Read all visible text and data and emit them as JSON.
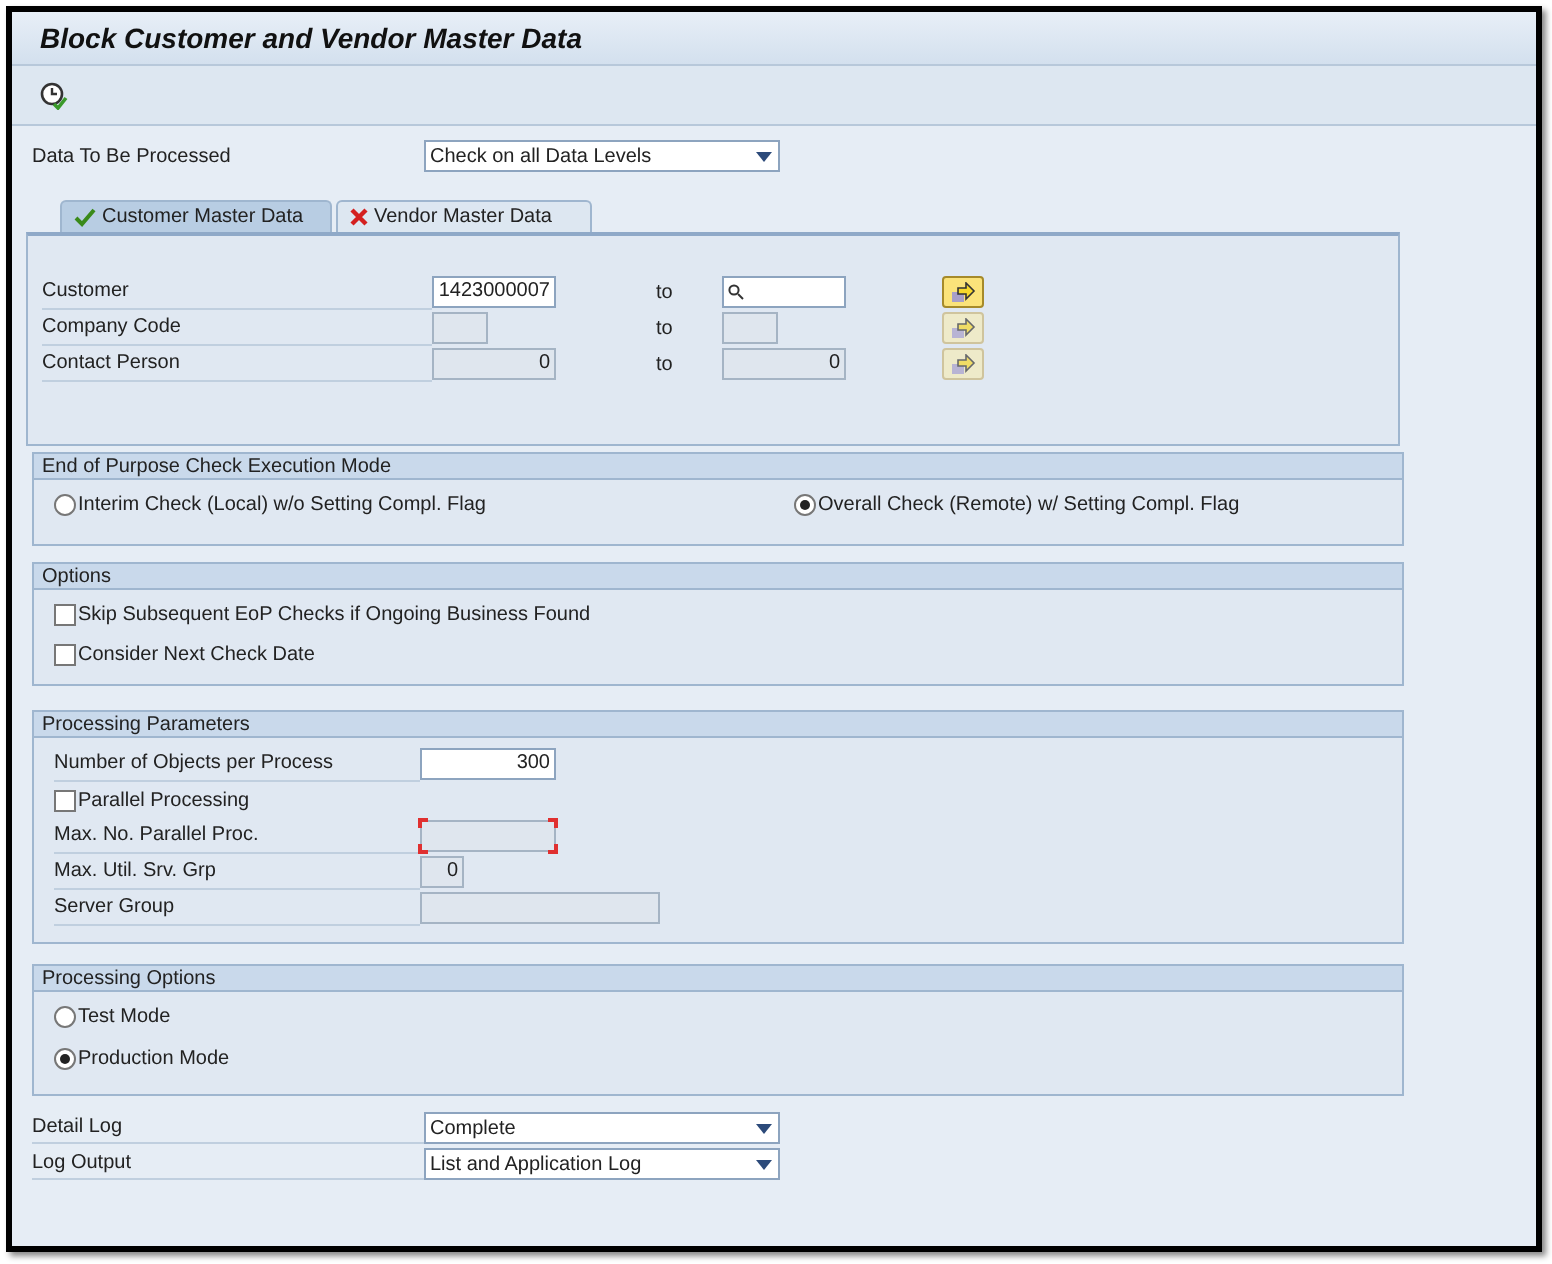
{
  "window": {
    "title": "Block Customer and Vendor Master Data"
  },
  "data_to_be_processed": {
    "label": "Data To Be Processed",
    "value": "Check on all Data Levels"
  },
  "tabs": [
    {
      "label": "Customer Master Data",
      "selected": true,
      "kind": "check"
    },
    {
      "label": "Vendor Master Data",
      "selected": false,
      "kind": "cross"
    }
  ],
  "selection_rows": [
    {
      "label": "Customer",
      "from": "1423000007",
      "to_label": "to",
      "to": "",
      "disabled": false,
      "search": true,
      "active": true
    },
    {
      "label": "Company Code",
      "from": "",
      "to_label": "to",
      "to": "",
      "disabled": true,
      "search": false,
      "active": false
    },
    {
      "label": "Contact Person",
      "from": "0",
      "to_label": "to",
      "to": "0",
      "disabled": true,
      "search": false,
      "active": false
    }
  ],
  "execution_mode": {
    "title": "End of Purpose Check Execution Mode",
    "options": [
      {
        "label": "Interim Check (Local) w/o Setting Compl. Flag",
        "selected": false
      },
      {
        "label": "Overall Check (Remote)  w/ Setting Compl. Flag",
        "selected": true
      }
    ]
  },
  "options": {
    "title": "Options",
    "items": [
      {
        "label": "Skip Subsequent EoP Checks if Ongoing Business Found",
        "checked": false
      },
      {
        "label": "Consider Next Check Date",
        "checked": false
      }
    ]
  },
  "processing_parameters": {
    "title": "Processing Parameters",
    "items": [
      {
        "kind": "field",
        "label": "Number of Objects per Process",
        "value": "300",
        "disabled": false,
        "focused": false
      },
      {
        "kind": "checkbox",
        "label": "Parallel Processing",
        "checked": false
      },
      {
        "kind": "field",
        "label": "Max. No. Parallel Proc.",
        "value": "",
        "disabled": true,
        "focused": true
      },
      {
        "kind": "field",
        "label": "Max. Util. Srv. Grp",
        "value": "0",
        "disabled": true,
        "focused": false
      },
      {
        "kind": "field",
        "label": "Server Group",
        "value": "",
        "disabled": true,
        "focused": false
      }
    ]
  },
  "processing_options": {
    "title": "Processing Options",
    "options": [
      {
        "label": "Test Mode",
        "selected": false
      },
      {
        "label": "Production Mode",
        "selected": true
      }
    ]
  },
  "log_settings": [
    {
      "label": "Detail Log",
      "value": "Complete"
    },
    {
      "label": "Log Output",
      "value": "List and Application Log"
    }
  ]
}
